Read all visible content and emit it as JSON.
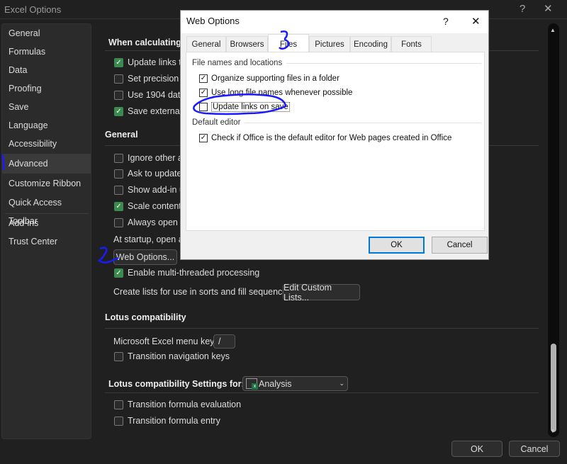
{
  "window": {
    "title": "Excel Options",
    "help": "?",
    "close": "✕"
  },
  "sidebar": {
    "items": [
      {
        "label": "General"
      },
      {
        "label": "Formulas"
      },
      {
        "label": "Data"
      },
      {
        "label": "Proofing"
      },
      {
        "label": "Save"
      },
      {
        "label": "Language"
      },
      {
        "label": "Accessibility"
      },
      {
        "label": "Advanced",
        "selected": true
      },
      {
        "label": "Customize Ribbon"
      },
      {
        "label": "Quick Access Toolbar"
      },
      {
        "label": "Add-ins"
      },
      {
        "label": "Trust Center"
      }
    ]
  },
  "content": {
    "calc_header": "When calculating t",
    "calc_items": [
      {
        "label": "Update links to",
        "checked": true
      },
      {
        "label": "Set precision as",
        "checked": false
      },
      {
        "label": "Use 1904 date",
        "checked": false
      },
      {
        "label": "Save external li",
        "checked": true
      }
    ],
    "general_header": "General",
    "general_items": [
      {
        "label": "Ignore other ap",
        "checked": false
      },
      {
        "label": "Ask to update a",
        "checked": false
      },
      {
        "label": "Show add-in us",
        "checked": false
      },
      {
        "label": "Scale content fo",
        "checked": true
      },
      {
        "label": "Always open en",
        "checked": false
      }
    ],
    "startup_text": "At startup, open al",
    "web_options_button": "Web Options...",
    "multithread": {
      "label": "Enable multi-threaded processing",
      "checked": true
    },
    "custom_lists_label": "Create lists for use in sorts and fill sequences:",
    "custom_lists_button": "Edit Custom Lists...",
    "lotus_header": "Lotus compatibility",
    "menu_key_label": "Microsoft Excel menu key:",
    "menu_key_value": "/",
    "transition_nav": {
      "label": "Transition navigation keys",
      "checked": false
    },
    "lotus_settings_label": "Lotus compatibility Settings for:",
    "lotus_settings_value": "Analysis",
    "transition_formula_eval": {
      "label": "Transition formula evaluation",
      "checked": false
    },
    "transition_formula_entry": {
      "label": "Transition formula entry",
      "checked": false
    }
  },
  "footer": {
    "ok": "OK",
    "cancel": "Cancel"
  },
  "web_options": {
    "title": "Web Options",
    "help": "?",
    "close": "✕",
    "tabs": [
      {
        "label": "General"
      },
      {
        "label": "Browsers"
      },
      {
        "label": "Files",
        "selected": true
      },
      {
        "label": "Pictures"
      },
      {
        "label": "Encoding"
      },
      {
        "label": "Fonts"
      }
    ],
    "group1": "File names and locations",
    "items": [
      {
        "label": "Organize supporting files in a folder",
        "checked": true
      },
      {
        "label": "Use long file names whenever possible",
        "checked": true
      },
      {
        "label": "Update links on save",
        "checked": false
      }
    ],
    "group2": "Default editor",
    "default_editor": {
      "label": "Check if Office is the default editor for Web pages created in Office",
      "checked": true
    },
    "ok": "OK",
    "cancel": "Cancel"
  },
  "annotations": {
    "color": "#1a1aff"
  }
}
